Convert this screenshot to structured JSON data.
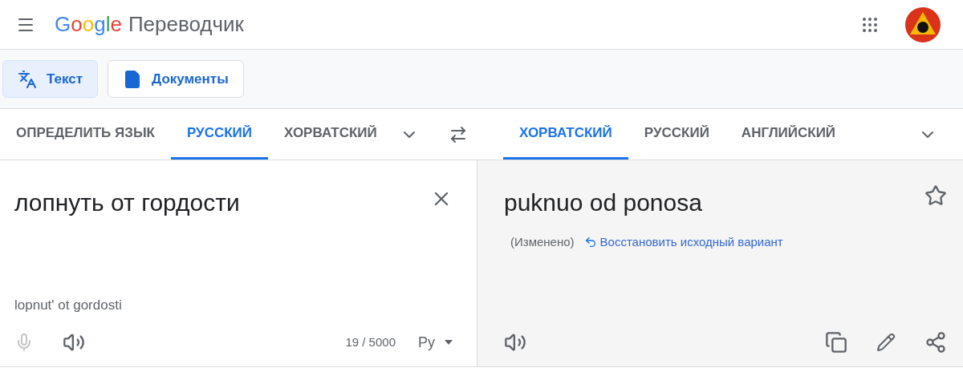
{
  "header": {
    "logo": "Google",
    "product": "Переводчик"
  },
  "modes": [
    {
      "label": "Текст",
      "kind": "text",
      "selected": true
    },
    {
      "label": "Документы",
      "kind": "docs",
      "selected": false
    }
  ],
  "source_langs": [
    {
      "label": "ОПРЕДЕЛИТЬ ЯЗЫК",
      "selected": false
    },
    {
      "label": "РУССКИЙ",
      "selected": true
    },
    {
      "label": "ХОРВАТСКИЙ",
      "selected": false
    }
  ],
  "target_langs": [
    {
      "label": "ХОРВАТСКИЙ",
      "selected": true
    },
    {
      "label": "РУССКИЙ",
      "selected": false
    },
    {
      "label": "АНГЛИЙСКИЙ",
      "selected": false
    }
  ],
  "source": {
    "text": "лопнуть от гордости",
    "transliteration": "lopnut' ot gordosti",
    "mic_disabled": true,
    "count": "19 / 5000",
    "keyboard": "Ру"
  },
  "target": {
    "text": "puknuo od ponosa",
    "starred": false,
    "edited_note": "(Изменено)",
    "restore_link": "Восстановить исходный вариант"
  }
}
